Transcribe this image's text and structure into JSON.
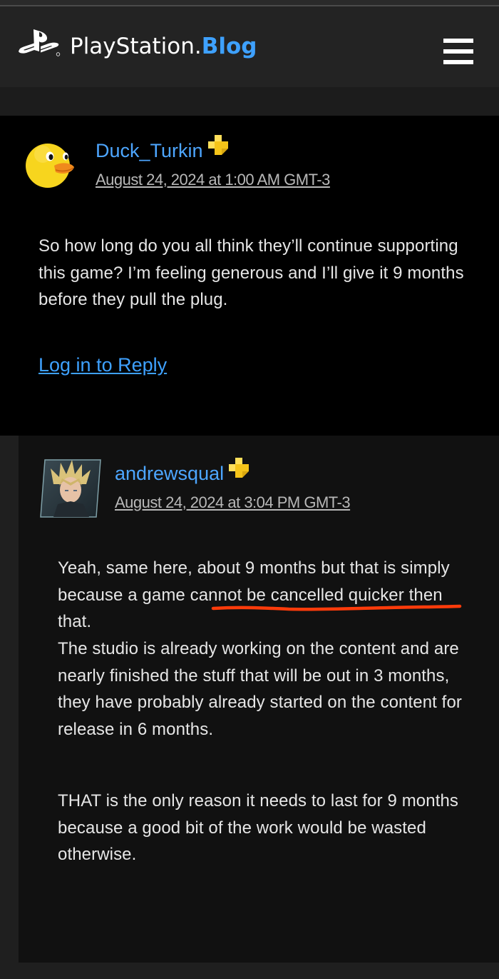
{
  "header": {
    "brand_name": "PlayStation.",
    "brand_blog": "Blog",
    "logo_icon": "playstation-logo-icon",
    "menu_icon": "hamburger-menu-icon"
  },
  "comments": [
    {
      "author": "Duck_Turkin",
      "badge_icon": "ps-plus-icon",
      "avatar": "duck-avatar",
      "date": "August 24, 2024 at 1:00 AM GMT-3",
      "paragraphs": [
        "So how long do you all think they’ll continue supporting this game? I’m feeling generous and I’ll give it 9 months before they pull the plug."
      ],
      "reply_label": "Log in to Reply"
    },
    {
      "author": "andrewsqual",
      "badge_icon": "ps-plus-icon",
      "avatar": "character-avatar",
      "date": "August 24, 2024 at 3:04 PM GMT-3",
      "paragraphs": [
        "Yeah, same here, about 9 months but that is simply because a game cannot be cancelled quicker then that.",
        "The studio is already working on the content and are nearly finished the stuff that will be out in 3 months, they have probably already started on the content for release in 6 months.",
        "THAT is the only reason it needs to last for 9 months because a good bit of the work would be wasted otherwise."
      ],
      "highlight_phrase": "game cannot be cancelled"
    }
  ],
  "colors": {
    "link_blue": "#3ea1ff",
    "plus_gold": "#f5c419",
    "annotation_red": "#ff3b0a"
  }
}
